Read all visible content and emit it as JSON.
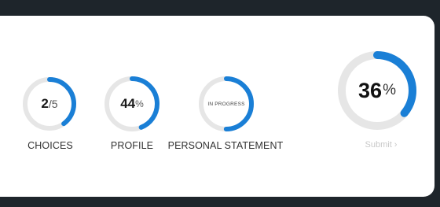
{
  "colors": {
    "accent": "#1a7fd6",
    "track": "#e6e6e6",
    "background": "#1e252b",
    "card": "#ffffff"
  },
  "progress": {
    "choices": {
      "value": "2",
      "total": "/5",
      "fraction": 0.4,
      "label": "CHOICES"
    },
    "profile": {
      "value": "44",
      "unit": "%",
      "fraction": 0.44,
      "label": "PROFILE"
    },
    "personal_statement": {
      "status": "IN PROGRESS",
      "fraction": 0.5,
      "label": "PERSONAL STATEMENT"
    },
    "overall": {
      "value": "36",
      "unit": "%",
      "fraction": 0.36
    }
  },
  "submit": {
    "label": "Submit ›"
  }
}
